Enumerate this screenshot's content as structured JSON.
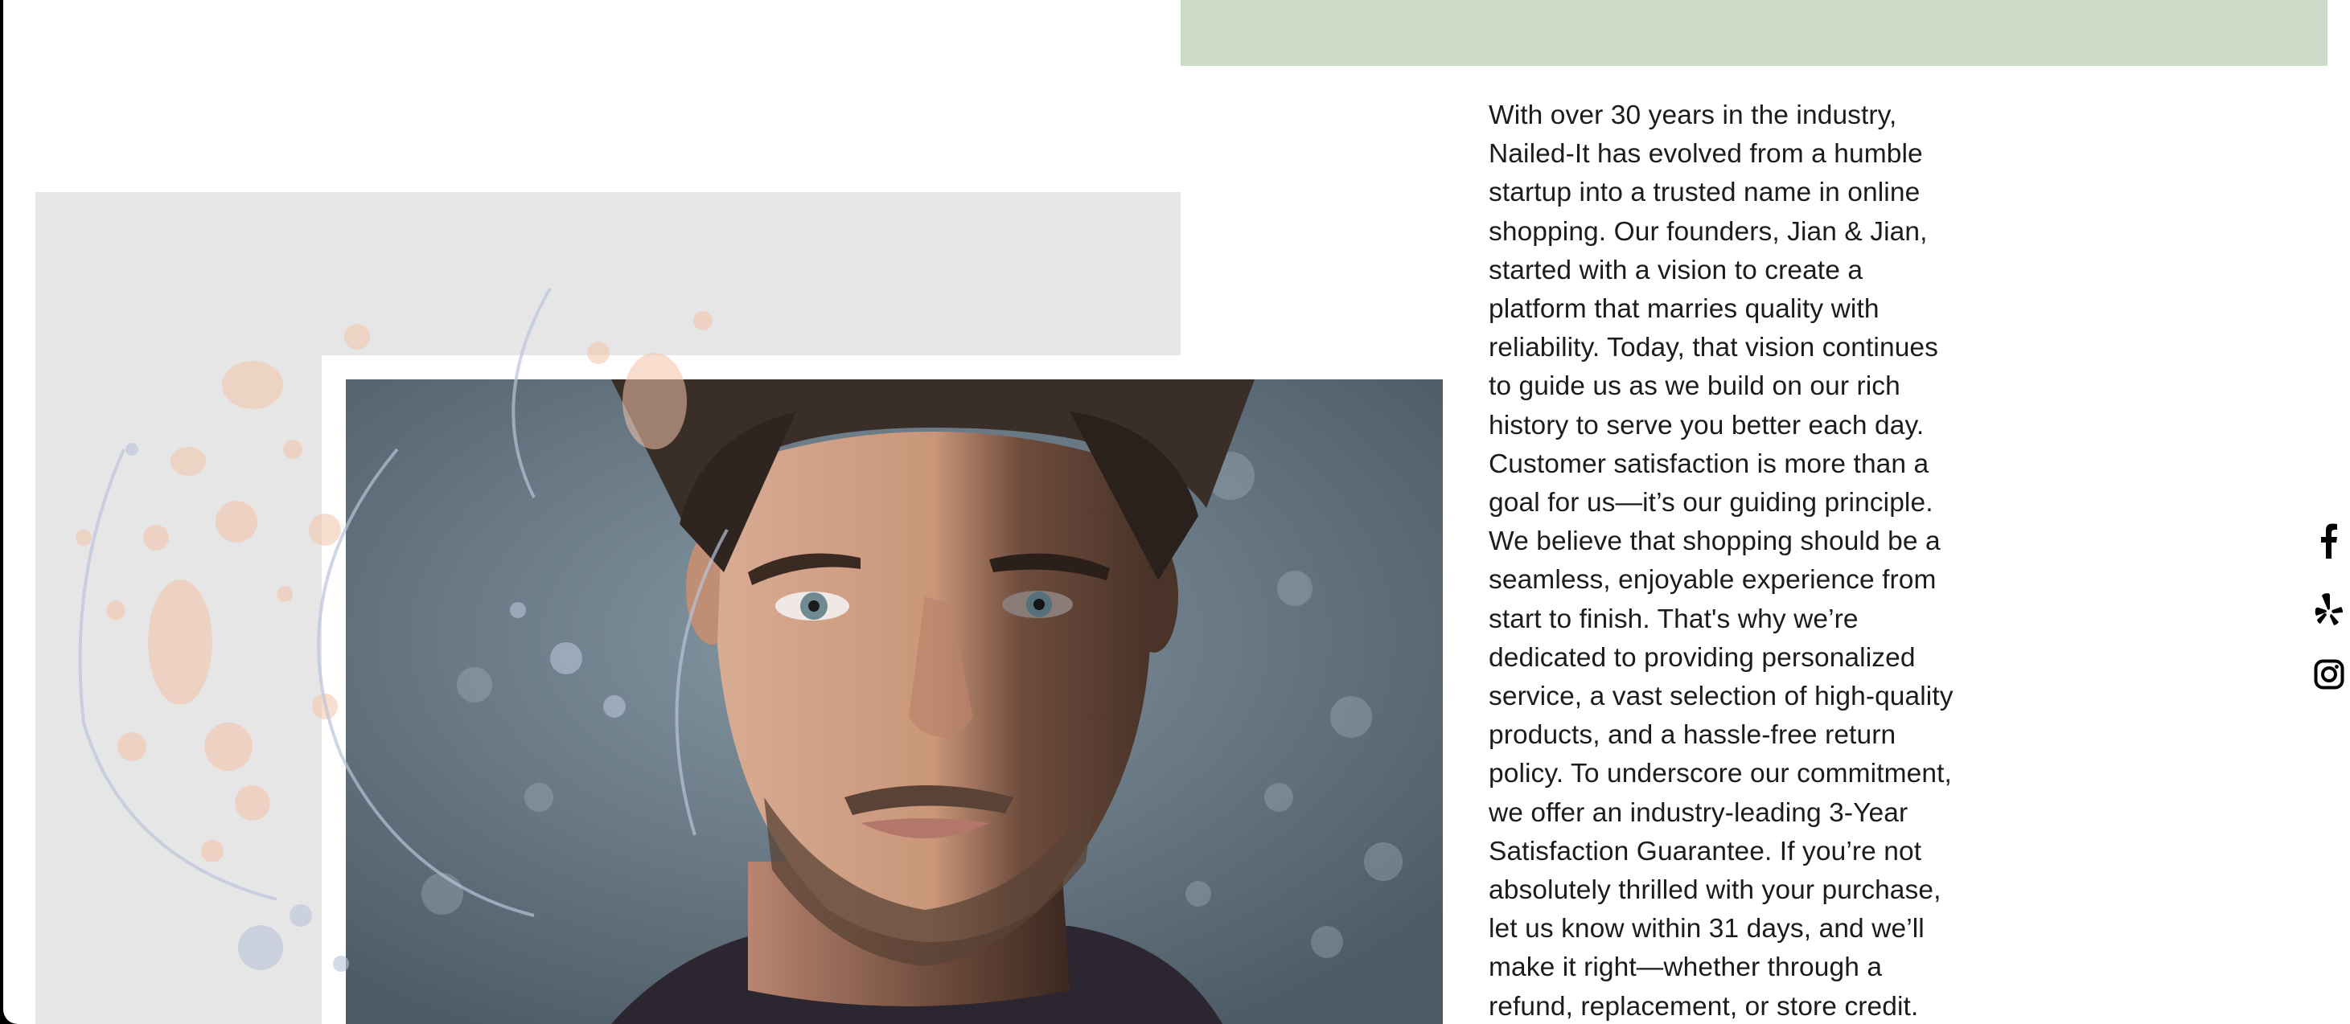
{
  "colors": {
    "green_band": "#cddbc9",
    "gray_panel": "#e7e6e7",
    "text": "#1c1c1c",
    "splatter_orange": "#f3c3a8",
    "splatter_blue": "#b9c3d8"
  },
  "hero": {
    "image": "portrait-photo"
  },
  "about": {
    "paragraph": "With over 30 years in the industry, Nailed-It has evolved from a humble startup into a trusted name in online shopping. Our founders, Jian & Jian, started with a vision to create a platform that marries quality with reliability. Today, that vision continues to guide us as we build on our rich history to serve you better each day. Customer satisfaction is more than a goal for us—it’s our guiding principle. We believe that shopping should be a seamless, enjoyable experience from start to finish. That's why we’re dedicated to providing personalized service, a vast selection of high-quality products, and a hassle-free return policy. To underscore our commitment, we offer an industry-leading 3-Year Satisfaction Guarantee. If you’re not absolutely thrilled with your purchase, let us know within 31 days, and we’ll make it right—whether through a refund, replacement, or store credit."
  },
  "social": {
    "links": [
      {
        "name": "facebook",
        "icon": "facebook-icon"
      },
      {
        "name": "yelp",
        "icon": "yelp-icon"
      },
      {
        "name": "instagram",
        "icon": "instagram-icon"
      }
    ]
  }
}
